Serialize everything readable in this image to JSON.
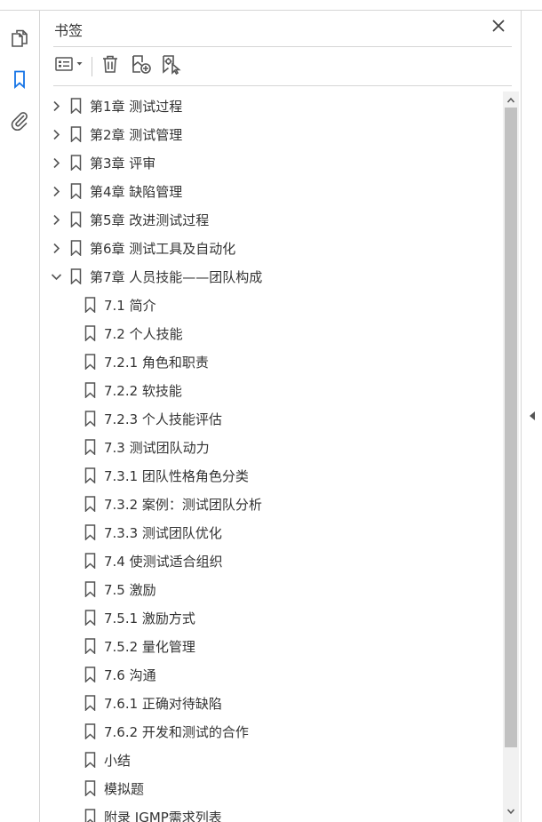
{
  "panel": {
    "title": "书签"
  },
  "icons": {
    "rail": [
      "pages-icon",
      "bookmarks-icon",
      "attachments-icon"
    ],
    "toolbar": [
      "options-menu-icon",
      "delete-icon",
      "new-bookmark-icon",
      "bookmark-from-selection-icon"
    ],
    "close": "close-icon",
    "collapse": "collapse-panel-icon"
  },
  "colors": {
    "active_rail_icon": "#1473e6",
    "text": "#333333",
    "icon": "#555555",
    "divider": "#d6d6d6",
    "scroll_track": "#f1f1f1",
    "scroll_thumb": "#c1c1c1"
  },
  "bookmarks": [
    {
      "label": "第1章  测试过程",
      "level": 0,
      "expander": "collapsed"
    },
    {
      "label": "第2章  测试管理",
      "level": 0,
      "expander": "collapsed"
    },
    {
      "label": "第3章  评审",
      "level": 0,
      "expander": "collapsed"
    },
    {
      "label": "第4章  缺陷管理",
      "level": 0,
      "expander": "collapsed"
    },
    {
      "label": "第5章  改进测试过程",
      "level": 0,
      "expander": "collapsed"
    },
    {
      "label": "第6章  测试工具及自动化",
      "level": 0,
      "expander": "collapsed"
    },
    {
      "label": "第7章  人员技能——团队构成",
      "level": 0,
      "expander": "expanded"
    },
    {
      "label": "7.1  简介",
      "level": 1
    },
    {
      "label": "7.2  个人技能",
      "level": 1
    },
    {
      "label": "7.2.1  角色和职责",
      "level": 1
    },
    {
      "label": "7.2.2  软技能",
      "level": 1
    },
    {
      "label": "7.2.3  个人技能评估",
      "level": 1
    },
    {
      "label": "7.3  测试团队动力",
      "level": 1
    },
    {
      "label": "7.3.1  团队性格角色分类",
      "level": 1
    },
    {
      "label": "7.3.2  案例：测试团队分析",
      "level": 1
    },
    {
      "label": "7.3.3  测试团队优化",
      "level": 1
    },
    {
      "label": "7.4  使测试适合组织",
      "level": 1
    },
    {
      "label": "7.5  激励",
      "level": 1
    },
    {
      "label": "7.5.1  激励方式",
      "level": 1
    },
    {
      "label": "7.5.2  量化管理",
      "level": 1
    },
    {
      "label": "7.6  沟通",
      "level": 1
    },
    {
      "label": "7.6.1  正确对待缺陷",
      "level": 1
    },
    {
      "label": "7.6.2  开发和测试的合作",
      "level": 1
    },
    {
      "label": "小结",
      "level": 1
    },
    {
      "label": "模拟题",
      "level": 1
    },
    {
      "label": "附录  IGMP需求列表",
      "level": 1
    }
  ]
}
